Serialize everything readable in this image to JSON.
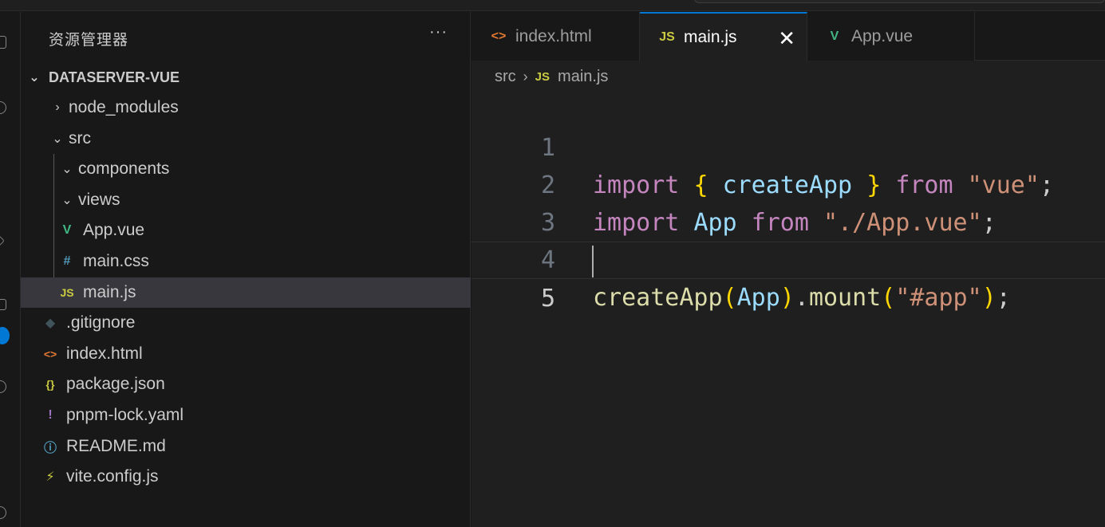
{
  "sidebar": {
    "title": "资源管理器",
    "more": "···",
    "root": "DATASERVER-VUE",
    "items": [
      {
        "label": "node_modules",
        "chevron": "›",
        "icon": "",
        "icon_name": "chevron-right-icon"
      },
      {
        "label": "src",
        "chevron": "⌄",
        "icon": "",
        "icon_name": "chevron-down-icon"
      },
      {
        "label": "components",
        "chevron": "⌄",
        "icon": "",
        "icon_name": "chevron-down-icon"
      },
      {
        "label": "views",
        "chevron": "⌄",
        "icon": "",
        "icon_name": "chevron-down-icon"
      },
      {
        "label": "App.vue",
        "icon": "V",
        "icon_name": "vue-file-icon",
        "icon_color": "#41b883"
      },
      {
        "label": "main.css",
        "icon": "#",
        "icon_name": "css-file-icon",
        "icon_color": "#519aba"
      },
      {
        "label": "main.js",
        "icon": "JS",
        "icon_name": "js-file-icon",
        "icon_color": "#cbcb41"
      },
      {
        "label": ".gitignore",
        "icon": "◆",
        "icon_name": "git-file-icon",
        "icon_color": "#41535b"
      },
      {
        "label": "index.html",
        "icon": "<>",
        "icon_name": "html-file-icon",
        "icon_color": "#e37933"
      },
      {
        "label": "package.json",
        "icon": "{}",
        "icon_name": "json-file-icon",
        "icon_color": "#cbcb41"
      },
      {
        "label": "pnpm-lock.yaml",
        "icon": "!",
        "icon_name": "yaml-file-icon",
        "icon_color": "#a074c4"
      },
      {
        "label": "README.md",
        "icon": "ⓘ",
        "icon_name": "info-file-icon",
        "icon_color": "#519aba"
      },
      {
        "label": "vite.config.js",
        "icon": "⚡",
        "icon_name": "vite-file-icon",
        "icon_color": "#cbcb41"
      }
    ]
  },
  "tabs": [
    {
      "label": "index.html",
      "icon": "<>",
      "icon_color": "#e37933",
      "active": false
    },
    {
      "label": "main.js",
      "icon": "JS",
      "icon_color": "#cbcb41",
      "active": true,
      "close": "✕"
    },
    {
      "label": "App.vue",
      "icon": "V",
      "icon_color": "#41b883",
      "active": false
    }
  ],
  "breadcrumb": {
    "folder": "src",
    "sep": "›",
    "file_icon": "JS",
    "file": "main.js"
  },
  "code": {
    "line_numbers": [
      "1",
      "2",
      "3",
      "4",
      "5"
    ],
    "current_line": 5
  },
  "colors": {
    "accent": "#0078d4",
    "keyword": "#c586c0",
    "string": "#ce9178",
    "function": "#dcdcaa",
    "identifier": "#9cdcfe",
    "bracket": "#ffd700"
  }
}
